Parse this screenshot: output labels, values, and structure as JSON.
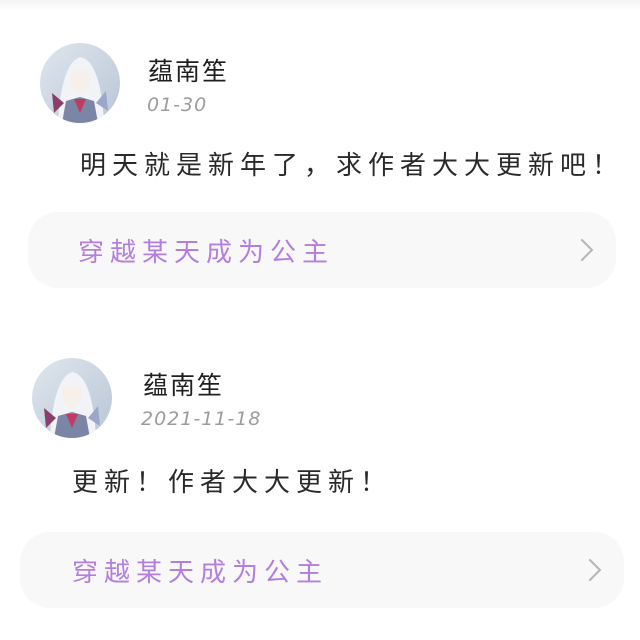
{
  "comments": [
    {
      "username": "蕴南笙",
      "date": "01-30",
      "text": "明天就是新年了，求作者大大更新吧！",
      "book_title": "穿越某天成为公主"
    },
    {
      "username": "蕴南笙",
      "date": "2021-11-18",
      "text": "更新！作者大大更新！",
      "book_title": "穿越某天成为公主"
    }
  ],
  "colors": {
    "accent": "#b37fde",
    "card_background": "#f8f8f8",
    "date_text": "#9c9c9c"
  },
  "icons": {
    "chevron": "chevron-right-icon"
  }
}
